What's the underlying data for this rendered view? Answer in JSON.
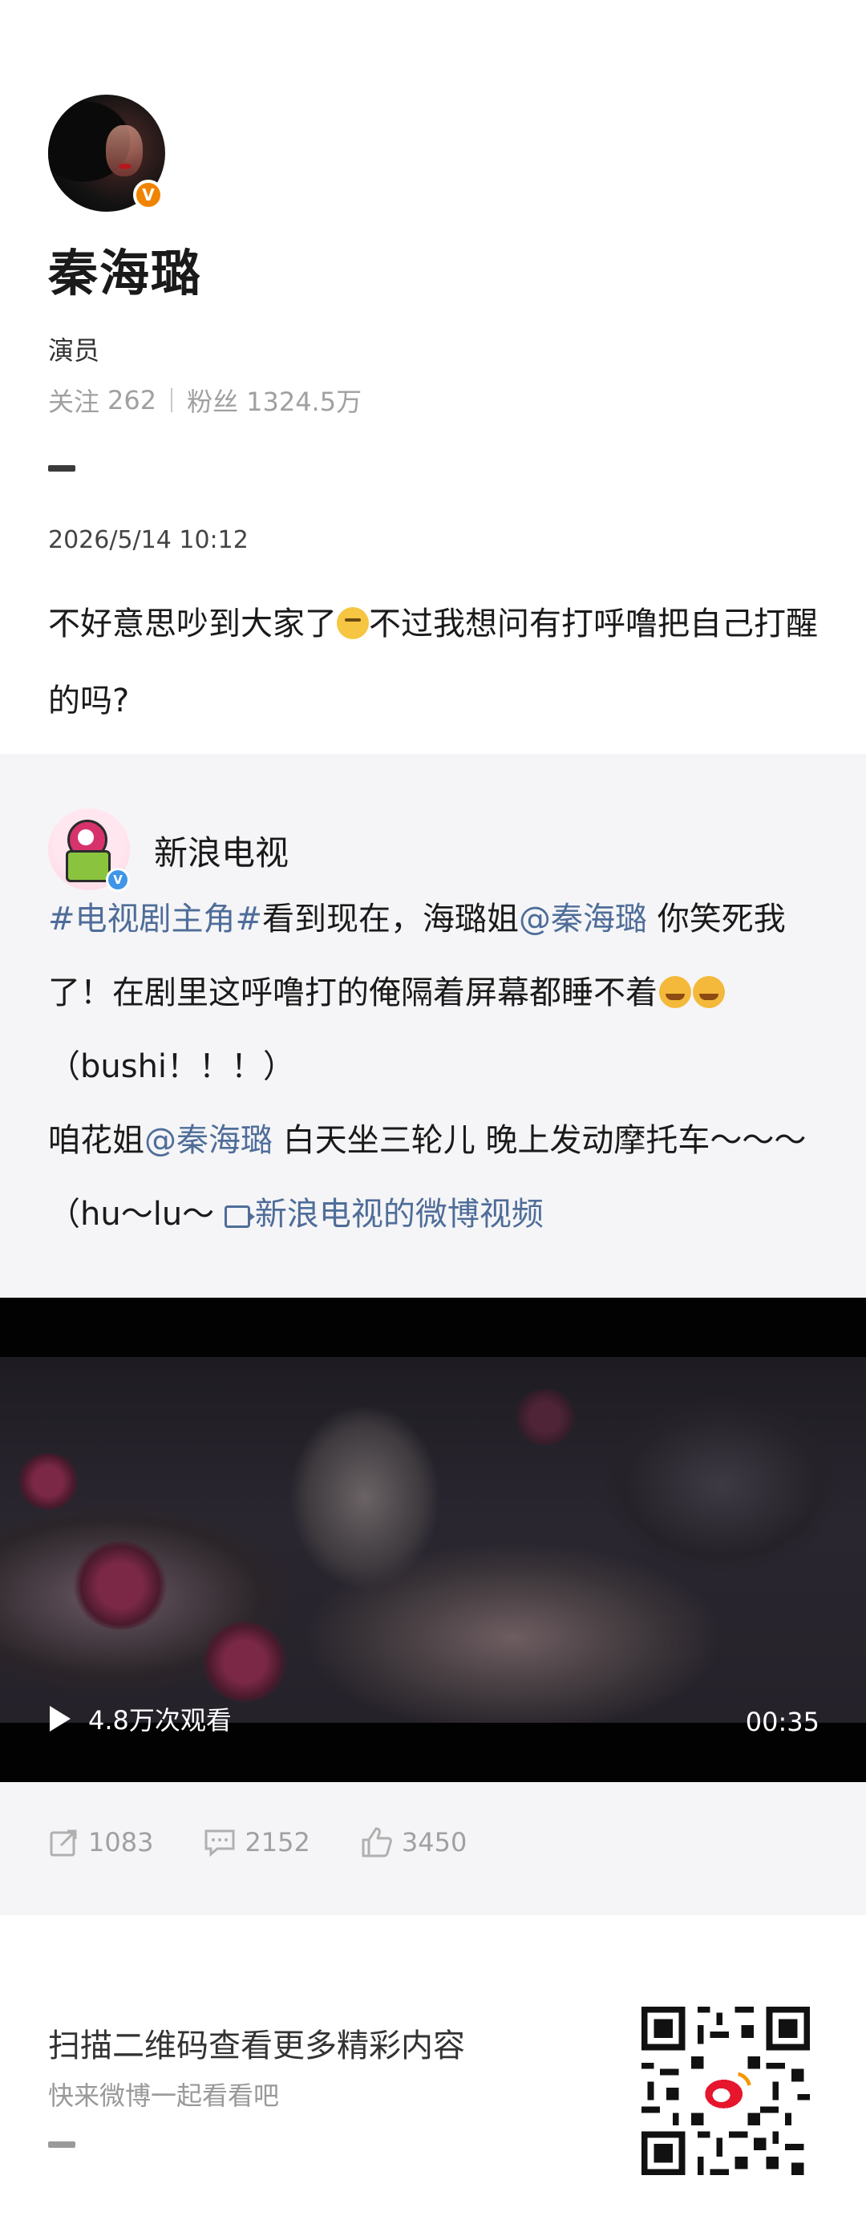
{
  "author": {
    "name": "秦海璐",
    "title": "演员",
    "following_label": "关注",
    "following": "262",
    "followers_label": "粉丝",
    "followers": "1324.5万",
    "verified_badge": "V"
  },
  "post": {
    "date": "2026/5/14 10:12",
    "text_part1": "不好意思吵到大家了",
    "text_part2": "不过我想问有打呼噜把自己打醒的吗?"
  },
  "repost": {
    "author_name": "新浪电视",
    "verified_badge": "V",
    "hashtag": "#电视剧主角#",
    "t1": "看到现在，海璐姐",
    "mention": "@秦海璐",
    "t2": " 你笑死我了！在剧里这呼噜打的俺隔着屏幕都睡不着",
    "t3": "（bushi！！！）",
    "t4": "咱花姐",
    "t5": " 白天坐三轮儿 晚上发动摩托车～～～（hu～lu～",
    "video_link": "新浪电视的微博视频"
  },
  "video": {
    "views": "4.8万次观看",
    "duration": "00:35"
  },
  "actions": {
    "reposts": "1083",
    "comments": "2152",
    "likes": "3450"
  },
  "footer": {
    "title": "扫描二维码查看更多精彩内容",
    "subtitle": "快来微博一起看看吧"
  },
  "colors": {
    "link": "#4f6d99",
    "verified_orange": "#f08300",
    "verified_blue": "#3f96e8",
    "repost_bg": "#f5f5f7"
  },
  "icons": [
    "verified-badge-icon",
    "thinking-emoji-icon",
    "laughing-cat-emoji-icon",
    "video-link-icon",
    "play-icon",
    "repost-icon",
    "comment-icon",
    "like-icon",
    "qr-code-icon"
  ]
}
